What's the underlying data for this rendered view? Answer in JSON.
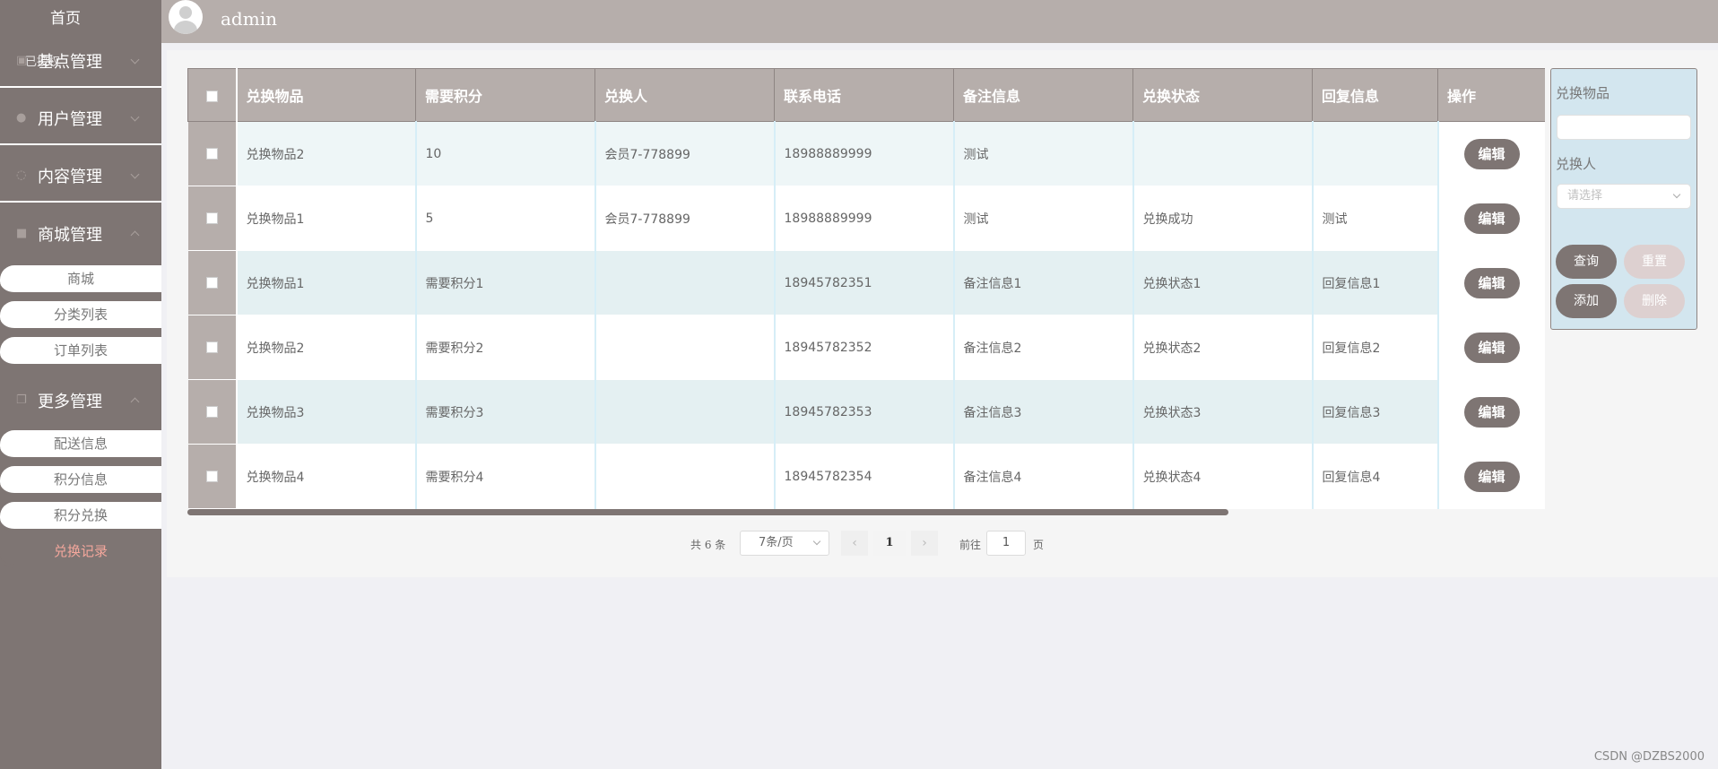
{
  "sidebar": {
    "home": "首页",
    "menus": [
      {
        "label": "基点管理",
        "overlay": "已授权",
        "icon": "gift-icon"
      },
      {
        "label": "用户管理",
        "icon": "user-icon"
      },
      {
        "label": "内容管理",
        "icon": "chat-icon"
      },
      {
        "label": "商城管理",
        "icon": "lock-icon"
      },
      {
        "label": "更多管理",
        "icon": "copy-icon"
      }
    ],
    "shop_items": [
      "商城",
      "分类列表",
      "订单列表"
    ],
    "more_items": [
      "配送信息",
      "积分信息",
      "积分兑换",
      "兑换记录"
    ]
  },
  "header": {
    "username": "admin"
  },
  "table": {
    "columns": [
      "兑换物品",
      "需要积分",
      "兑换人",
      "联系电话",
      "备注信息",
      "兑换状态",
      "回复信息",
      "操作"
    ],
    "edit_label": "编辑",
    "rows": [
      {
        "item": "兑换物品2",
        "points": "10",
        "person": "会员7-778899",
        "phone": "18988889999",
        "note": "测试",
        "status": "",
        "reply": ""
      },
      {
        "item": "兑换物品1",
        "points": "5",
        "person": "会员7-778899",
        "phone": "18988889999",
        "note": "测试",
        "status": "兑换成功",
        "reply": "测试"
      },
      {
        "item": "兑换物品1",
        "points": "需要积分1",
        "person": "",
        "phone": "18945782351",
        "note": "备注信息1",
        "status": "兑换状态1",
        "reply": "回复信息1"
      },
      {
        "item": "兑换物品2",
        "points": "需要积分2",
        "person": "",
        "phone": "18945782352",
        "note": "备注信息2",
        "status": "兑换状态2",
        "reply": "回复信息2"
      },
      {
        "item": "兑换物品3",
        "points": "需要积分3",
        "person": "",
        "phone": "18945782353",
        "note": "备注信息3",
        "status": "兑换状态3",
        "reply": "回复信息3"
      },
      {
        "item": "兑换物品4",
        "points": "需要积分4",
        "person": "",
        "phone": "18945782354",
        "note": "备注信息4",
        "status": "兑换状态4",
        "reply": "回复信息4"
      }
    ]
  },
  "pagination": {
    "total": "共 6 条",
    "page_size": "7条/页",
    "current_page": "1",
    "goto_label": "前往",
    "goto_value": "1",
    "page_unit": "页",
    "prev": "‹",
    "next": "›"
  },
  "search": {
    "item_label": "兑换物品",
    "item_value": "",
    "person_label": "兑换人",
    "person_placeholder": "请选择",
    "query": "查询",
    "reset": "重置",
    "add": "添加",
    "delete": "删除"
  },
  "watermark": "CSDN @DZBS2000"
}
